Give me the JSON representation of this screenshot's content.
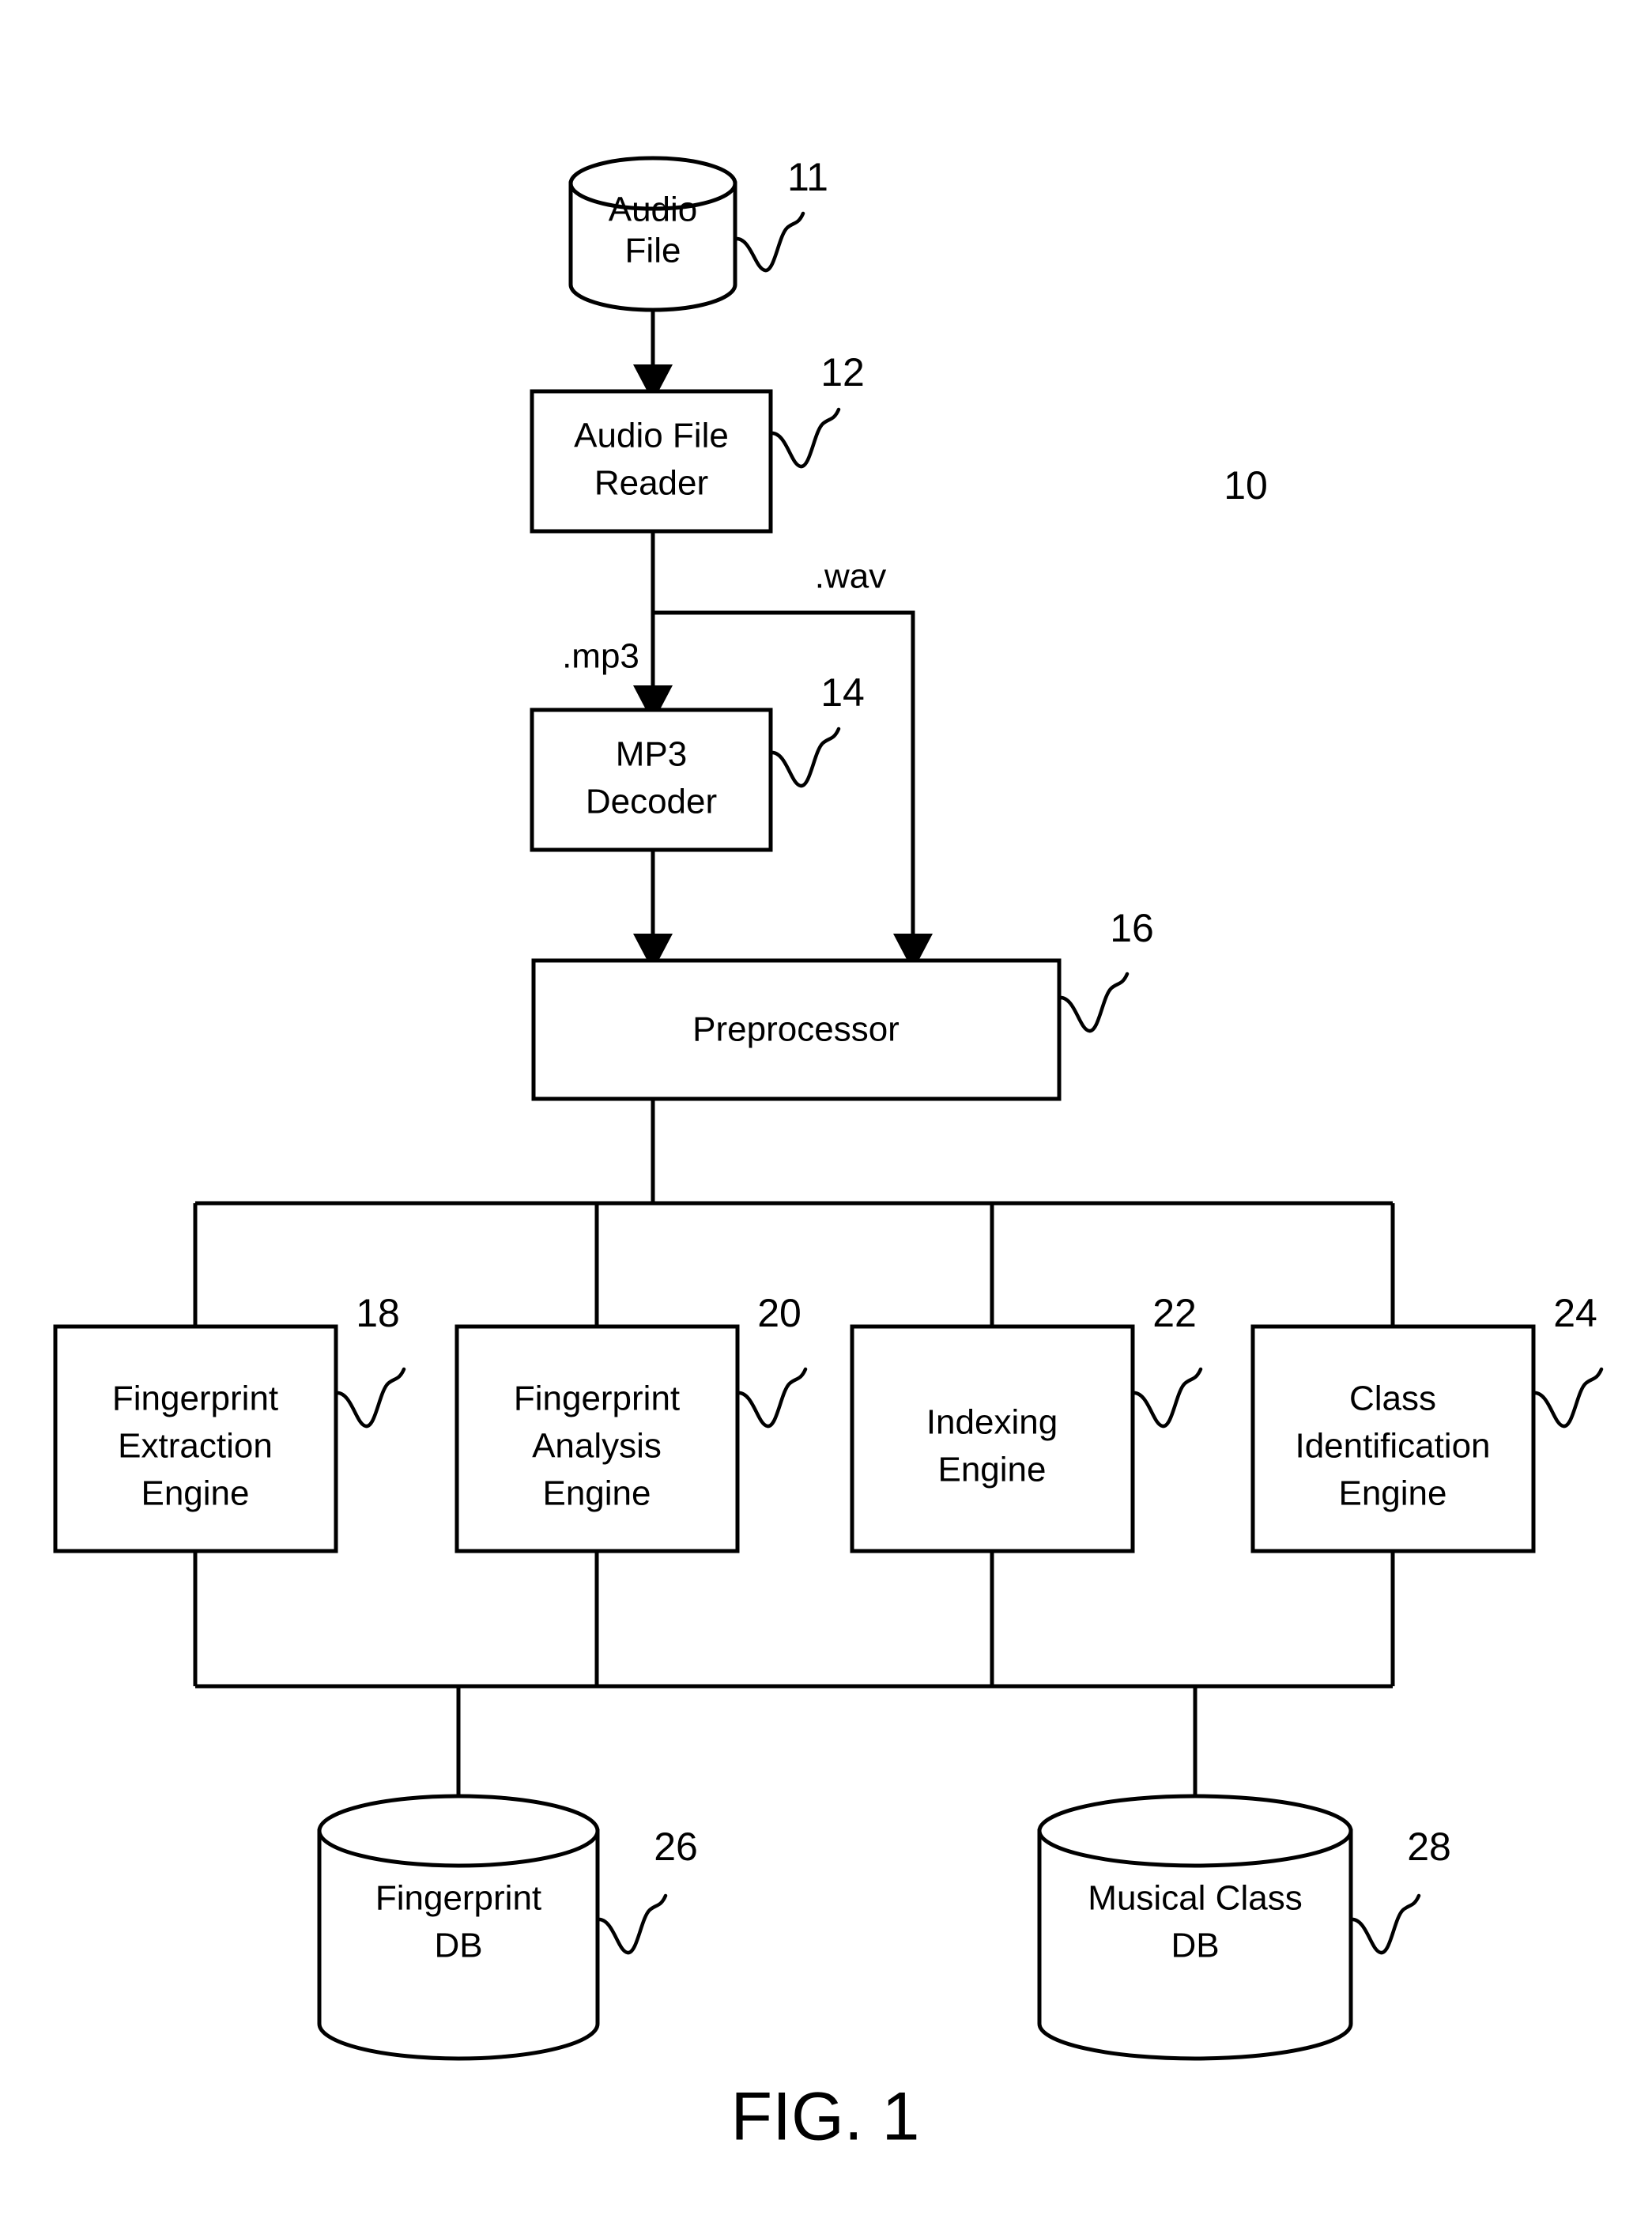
{
  "figure": {
    "caption": "FIG. 1",
    "system_reference": "10"
  },
  "nodes": {
    "audio_file": {
      "kind": "cylinder",
      "label_line1": "Audio",
      "label_line2": "File",
      "ref": "11"
    },
    "audio_file_reader": {
      "kind": "box",
      "label_line1": "Audio File",
      "label_line2": "Reader",
      "ref": "12"
    },
    "mp3_decoder": {
      "kind": "box",
      "label_line1": "MP3",
      "label_line2": "Decoder",
      "ref": "14"
    },
    "preprocessor": {
      "kind": "box",
      "label_line1": "Preprocessor",
      "ref": "16"
    },
    "fingerprint_extraction_engine": {
      "kind": "box",
      "label_line1": "Fingerprint",
      "label_line2": "Extraction",
      "label_line3": "Engine",
      "ref": "18"
    },
    "fingerprint_analysis_engine": {
      "kind": "box",
      "label_line1": "Fingerprint",
      "label_line2": "Analysis",
      "label_line3": "Engine",
      "ref": "20"
    },
    "indexing_engine": {
      "kind": "box",
      "label_line1": "Indexing",
      "label_line2": "Engine",
      "ref": "22"
    },
    "class_identification_engine": {
      "kind": "box",
      "label_line1": "Class",
      "label_line2": "Identification",
      "label_line3": "Engine",
      "ref": "24"
    },
    "fingerprint_db": {
      "kind": "cylinder",
      "label_line1": "Fingerprint",
      "label_line2": "DB",
      "ref": "26"
    },
    "musical_class_db": {
      "kind": "cylinder",
      "label_line1": "Musical Class",
      "label_line2": "DB",
      "ref": "28"
    }
  },
  "edges": {
    "mp3_branch_label": ".mp3",
    "wav_branch_label": ".wav"
  },
  "colors": {
    "ink": "#000000",
    "paper": "#ffffff"
  }
}
